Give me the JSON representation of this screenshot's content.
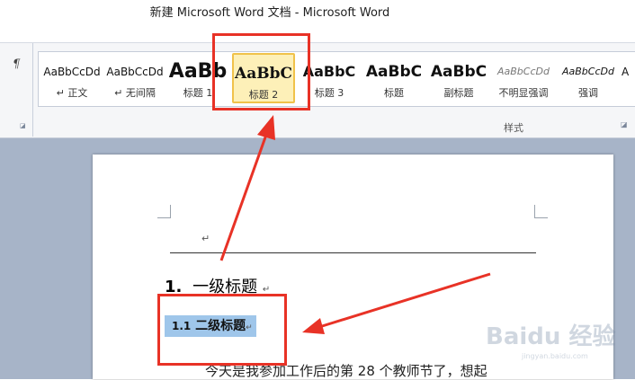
{
  "window": {
    "title": "新建 Microsoft Word 文档 - Microsoft Word"
  },
  "ribbon": {
    "left_glyph": "¶",
    "styles_group_label": "样式",
    "styles": [
      {
        "preview": "AaBbCcDd",
        "label": "↵ 正文"
      },
      {
        "preview": "AaBbCcDd",
        "label": "↵ 无间隔"
      },
      {
        "preview": "AaBb",
        "label": "标题 1"
      },
      {
        "preview": "AaBbC",
        "label": "标题 2",
        "selected": true
      },
      {
        "preview": "AaBbC",
        "label": "标题 3"
      },
      {
        "preview": "AaBbC",
        "label": "标题"
      },
      {
        "preview": "AaBbC",
        "label": "副标题"
      },
      {
        "preview": "AaBbCcDd",
        "label": "不明显强调"
      },
      {
        "preview": "AaBbCcDd",
        "label": "强调"
      },
      {
        "preview": "A",
        "label": ""
      }
    ]
  },
  "document": {
    "paragraph_mark": "↵",
    "heading1": {
      "number": "1.",
      "text": "一级标题"
    },
    "heading2": {
      "number": "1.1",
      "text": "二级标题"
    },
    "body_text": "今天是我参加工作后的第 28 个教师节了，想起"
  },
  "watermark": {
    "brand": "Baidu 经验",
    "url": "jingyan.baidu.com"
  },
  "colors": {
    "annotation_red": "#e83226",
    "selection_blue": "#9fc6ea",
    "selected_style_bg": "#fdf0b8"
  }
}
